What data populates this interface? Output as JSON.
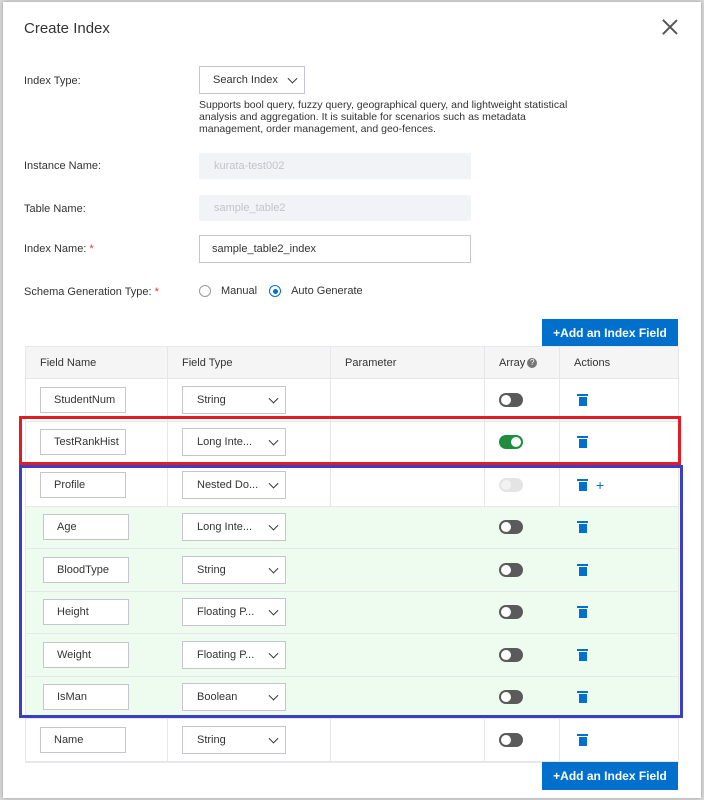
{
  "dialog": {
    "title": "Create Index"
  },
  "form": {
    "index_type_label": "Index Type:",
    "index_type_value": "Search Index",
    "index_type_desc": "Supports bool query, fuzzy query, geographical query, and lightweight statistical analysis and aggregation. It is suitable for scenarios such as metadata management, order management, and geo-fences.",
    "instance_label": "Instance Name:",
    "instance_value": "kurata-test002",
    "table_label": "Table Name:",
    "table_value": "sample_table2",
    "index_name_label": "Index Name:",
    "required_mark": "*",
    "index_name_value": "sample_table2_index",
    "schema_label": "Schema Generation Type:",
    "schema_options": [
      "Manual",
      "Auto Generate"
    ],
    "schema_selected": "Auto Generate"
  },
  "buttons": {
    "add_field": "+Add an Index Field"
  },
  "table": {
    "headers": [
      "Field Name",
      "Field Type",
      "Parameter",
      "Array",
      "Actions"
    ],
    "rows": [
      {
        "name": "StudentNum",
        "type": "String",
        "array": "off"
      },
      {
        "name": "TestRankHist",
        "type": "Long Inte...",
        "array": "on"
      },
      {
        "name": "Profile",
        "type": "Nested Do...",
        "array": "disabled"
      },
      {
        "name": "Age",
        "type": "Long Inte...",
        "array": "off"
      },
      {
        "name": "BloodType",
        "type": "String",
        "array": "off"
      },
      {
        "name": "Height",
        "type": "Floating P...",
        "array": "off"
      },
      {
        "name": "Weight",
        "type": "Floating P...",
        "array": "off"
      },
      {
        "name": "IsMan",
        "type": "Boolean",
        "array": "off"
      },
      {
        "name": "Name",
        "type": "String",
        "array": "off"
      }
    ]
  },
  "colors": {
    "primary": "#0070cc",
    "toggle_on": "#1e8e3e",
    "nested_bg": "#edfcef",
    "highlight_red": "#e41b22",
    "highlight_blue": "#3b3fc4"
  }
}
